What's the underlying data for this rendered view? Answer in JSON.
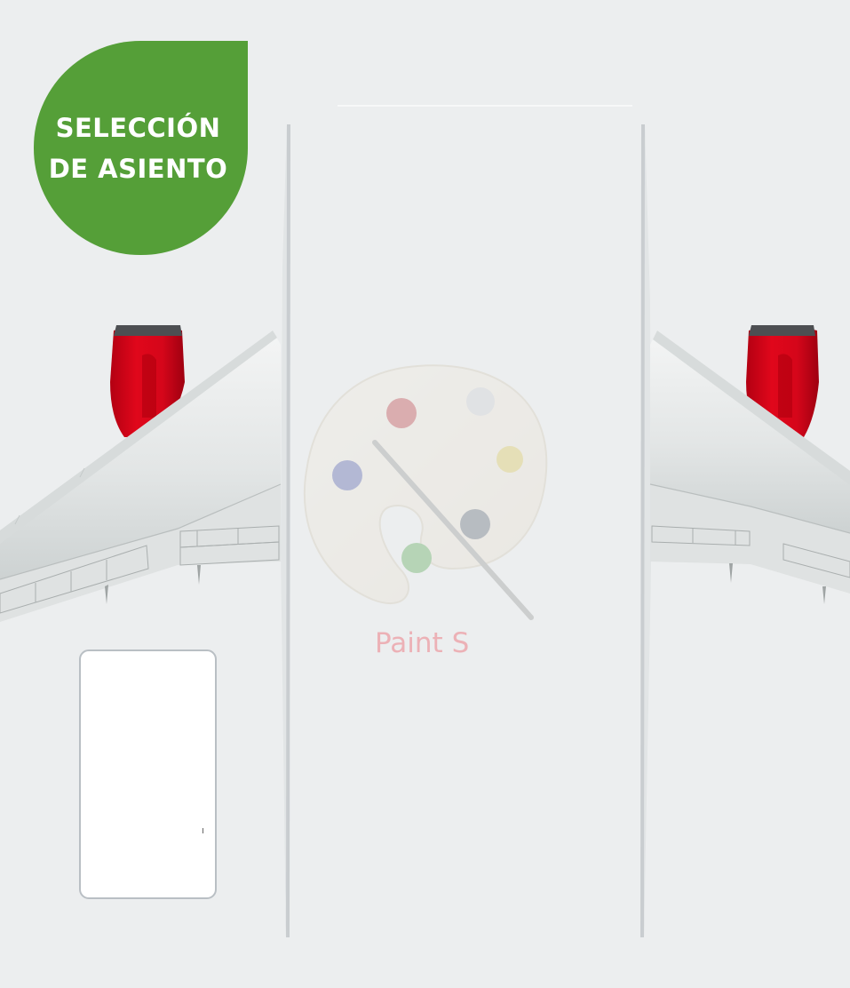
{
  "header": {
    "badge_line1": "SELECCIÓN",
    "badge_line2": "DE ASIENTO"
  },
  "watermark": {
    "label": "Paint S"
  },
  "colors": {
    "badge": "#559f38",
    "engine": "#d9071a",
    "background": "#eceeef"
  },
  "icons": [
    "paint-palette-icon"
  ]
}
